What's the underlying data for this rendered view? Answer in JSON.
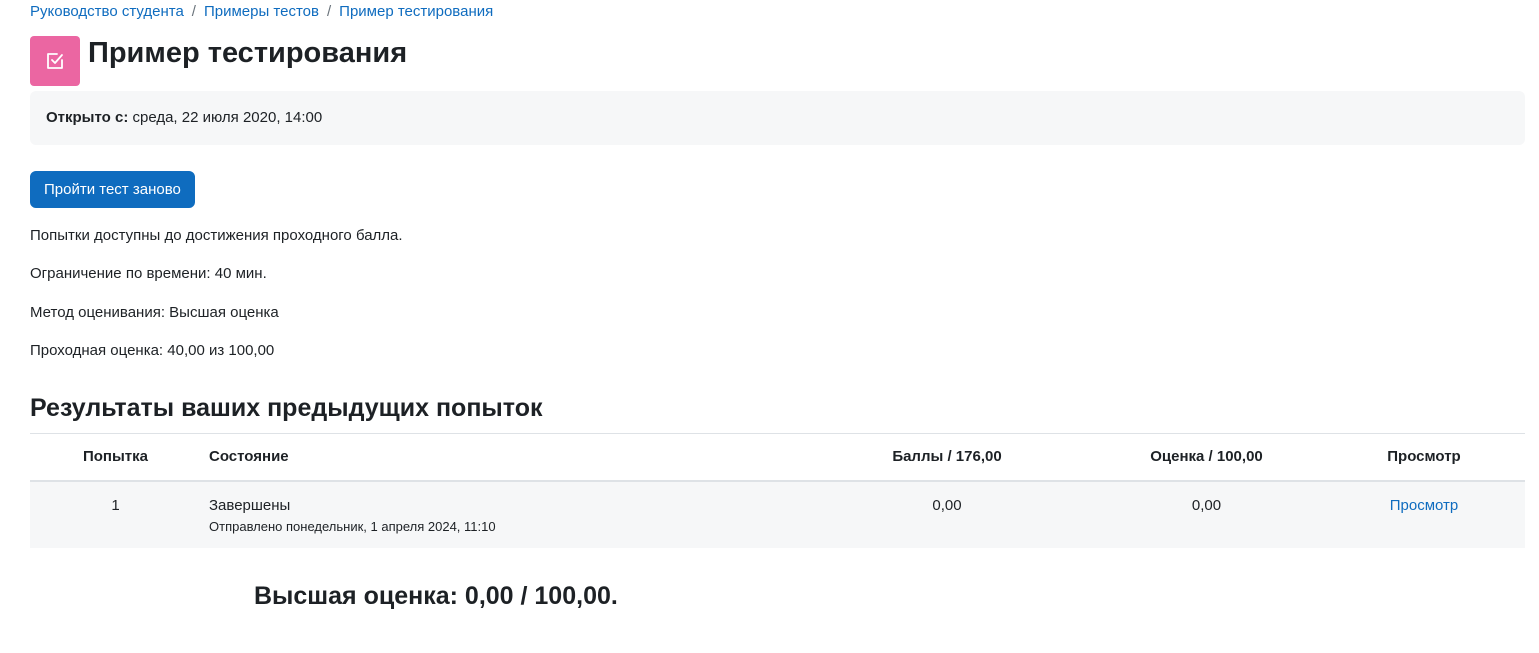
{
  "breadcrumb": [
    {
      "label": "Руководство студента"
    },
    {
      "label": "Примеры тестов"
    },
    {
      "label": "Пример тестирования"
    }
  ],
  "breadcrumb_separator": "/",
  "page": {
    "title": "Пример тестирования",
    "icon": "quiz-checkbox-icon",
    "icon_color": "#eb66a2"
  },
  "open_info": {
    "label": "Открыто с:",
    "value": "среда, 22 июля 2020, 14:00"
  },
  "retake_button": {
    "label": "Пройти тест заново",
    "color": "#0f6cbf"
  },
  "quiz_info": {
    "attempts": "Попытки доступны до достижения проходного балла.",
    "time_limit": "Ограничение по времени: 40 мин.",
    "grading_method": "Метод оценивания: Высшая оценка",
    "pass_grade": "Проходная оценка: 40,00 из 100,00"
  },
  "results": {
    "title": "Результаты ваших предыдущих попыток",
    "columns": {
      "attempt": "Попытка",
      "state": "Состояние",
      "marks": "Баллы / 176,00",
      "grade": "Оценка / 100,00",
      "review": "Просмотр"
    },
    "rows": [
      {
        "attempt": "1",
        "state": "Завершены",
        "submitted": "Отправлено понедельник, 1 апреля 2024, 11:10",
        "marks": "0,00",
        "grade": "0,00",
        "review": "Просмотр"
      }
    ]
  },
  "highest_grade": "Высшая оценка: 0,00 / 100,00.",
  "colors": {
    "link": "#0f6cbf",
    "text": "#1d2125",
    "panel_bg": "#f6f7f8"
  }
}
